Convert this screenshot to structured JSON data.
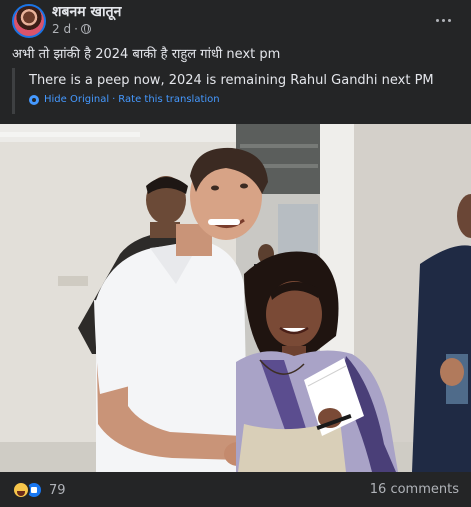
{
  "post": {
    "author": "शबनम खातून",
    "time": "2 d",
    "separator": "·",
    "text": "अभी तो झांकी है 2024 बाकी है राहुल गांधी next pm",
    "translation": {
      "text": "There is a peep now, 2024 is remaining Rahul Gandhi next PM",
      "hide_link": "Hide Original",
      "link_separator": "·",
      "rate_link": "Rate this translation"
    },
    "footer": {
      "reaction_count": "79",
      "comments": "16 comments"
    }
  },
  "colors": {
    "background": "#242526",
    "text": "#e4e6eb",
    "secondary_text": "#b0b3b8",
    "link": "#4599ff",
    "like": "#1877f2",
    "haha": "#f7c64b"
  },
  "icons": [
    "globe-icon",
    "more-options-icon",
    "translate-icon",
    "haha-reaction-icon",
    "like-reaction-icon"
  ]
}
